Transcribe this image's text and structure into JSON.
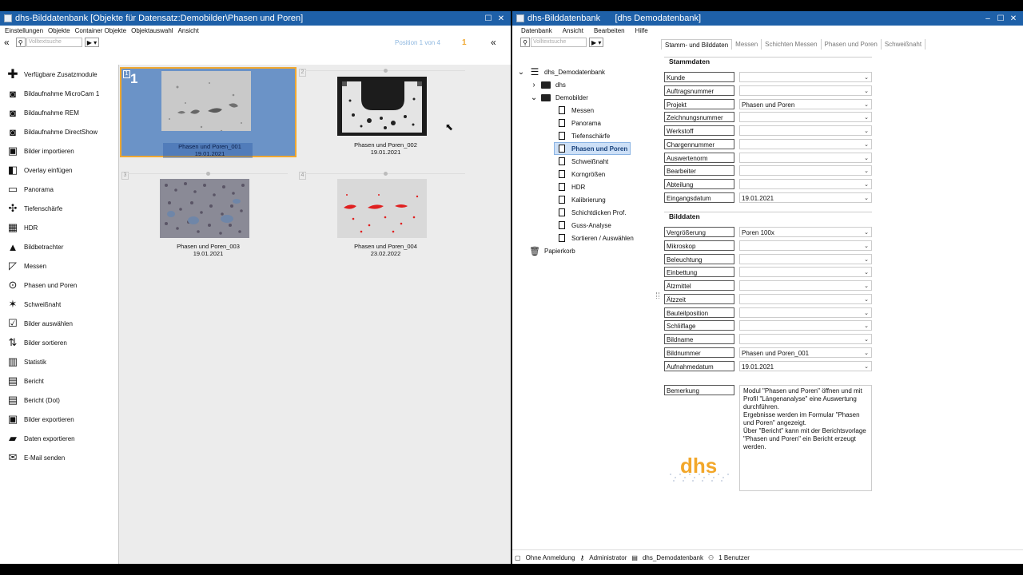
{
  "left_window": {
    "title": "dhs-Bilddatenbank [Objekte für Datensatz:Demobilder\\Phasen und Poren]",
    "menu": [
      "Einstellungen",
      "Objekte",
      "Container Objekte",
      "Objektauswahl",
      "Ansicht"
    ],
    "search_placeholder": "Volltextsuche",
    "position_text": "Position 1 von 4",
    "selected_count": "1",
    "sidebar": [
      {
        "label": "Verfügbare Zusatzmodule",
        "icon": "puzzle-icon",
        "glyph": "✚"
      },
      {
        "label": "Bildaufnahme MicroCam 1",
        "icon": "camera-icon",
        "glyph": "◙"
      },
      {
        "label": "Bildaufnahme REM",
        "icon": "camera-icon",
        "glyph": "◙"
      },
      {
        "label": "Bildaufnahme DirectShow",
        "icon": "camera-icon",
        "glyph": "◙"
      },
      {
        "label": "Bilder importieren",
        "icon": "import-icon",
        "glyph": "▣"
      },
      {
        "label": "Overlay einfügen",
        "icon": "overlay-icon",
        "glyph": "◧"
      },
      {
        "label": "Panorama",
        "icon": "panorama-icon",
        "glyph": "▭"
      },
      {
        "label": "Tiefenschärfe",
        "icon": "focus-icon",
        "glyph": "✣"
      },
      {
        "label": "HDR",
        "icon": "hdr-icon",
        "glyph": "▦"
      },
      {
        "label": "Bildbetrachter",
        "icon": "image-viewer-icon",
        "glyph": "▲"
      },
      {
        "label": "Messen",
        "icon": "measure-icon",
        "glyph": "◸"
      },
      {
        "label": "Phasen und Poren",
        "icon": "phases-icon",
        "glyph": "⊙"
      },
      {
        "label": "Schweißnaht",
        "icon": "weld-icon",
        "glyph": "✶"
      },
      {
        "label": "Bilder auswählen",
        "icon": "checklist-icon",
        "glyph": "☑"
      },
      {
        "label": "Bilder sortieren",
        "icon": "sort-icon",
        "glyph": "⇅"
      },
      {
        "label": "Statistik",
        "icon": "statistics-icon",
        "glyph": "▥"
      },
      {
        "label": "Bericht",
        "icon": "report-icon",
        "glyph": "▤"
      },
      {
        "label": "Bericht (Dot)",
        "icon": "report-dot-icon",
        "glyph": "▤"
      },
      {
        "label": "Bilder exportieren",
        "icon": "export-images-icon",
        "glyph": "▣"
      },
      {
        "label": "Daten exportieren",
        "icon": "export-data-icon",
        "glyph": "▰"
      },
      {
        "label": "E-Mail senden",
        "icon": "mail-icon",
        "glyph": "✉"
      }
    ],
    "thumbnails": [
      {
        "num": "1",
        "name": "Phasen und Poren_001",
        "date": "19.01.2021"
      },
      {
        "num": "2",
        "name": "Phasen und Poren_002",
        "date": "19.01.2021"
      },
      {
        "num": "3",
        "name": "Phasen und Poren_003",
        "date": "19.01.2021"
      },
      {
        "num": "4",
        "name": "Phasen und Poren_004",
        "date": "23.02.2022"
      }
    ]
  },
  "right_window": {
    "title": "dhs-Bilddatenbank      [dhs Demodatenbank]",
    "menu": [
      "Datenbank",
      "Ansicht",
      "Bearbeiten",
      "Hilfe"
    ],
    "search_placeholder": "Volltextsuche",
    "tree": {
      "root": "dhs_Demodatenbank",
      "dhs": "dhs",
      "demobilder": "Demobilder",
      "children": [
        "Messen",
        "Panorama",
        "Tiefenschärfe",
        "Phasen und Poren",
        "Schweißnaht",
        "Korngrößen",
        "HDR",
        "Kalibrierung",
        "Schichtdicken Prof.",
        "Guss-Analyse",
        "Sortieren / Auswählen"
      ],
      "trash": "Papierkorb"
    },
    "tabs": [
      "Stamm- und Bilddaten",
      "Messen",
      "Schichten Messen",
      "Phasen und Poren",
      "Schweißnaht"
    ],
    "stammdaten_title": "Stammdaten",
    "stammdaten": [
      {
        "label": "Kunde",
        "value": ""
      },
      {
        "label": "Auftragsnummer",
        "value": ""
      },
      {
        "label": "Projekt",
        "value": "Phasen und Poren"
      },
      {
        "label": "Zeichnungsnummer",
        "value": ""
      },
      {
        "label": "Werkstoff",
        "value": ""
      },
      {
        "label": "Chargennummer",
        "value": ""
      },
      {
        "label": "Auswertenorm",
        "value": ""
      },
      {
        "label": "Bearbeiter",
        "value": ""
      },
      {
        "label": "Abteilung",
        "value": ""
      },
      {
        "label": "Eingangsdatum",
        "value": "19.01.2021"
      }
    ],
    "bilddaten_title": "Bilddaten",
    "bilddaten": [
      {
        "label": "Vergrößerung",
        "value": "Poren 100x"
      },
      {
        "label": "Mikroskop",
        "value": ""
      },
      {
        "label": "Beleuchtung",
        "value": ""
      },
      {
        "label": "Einbettung",
        "value": ""
      },
      {
        "label": "Ätzmittel",
        "value": ""
      },
      {
        "label": "Ätzzeit",
        "value": ""
      },
      {
        "label": "Bauteilposition",
        "value": ""
      },
      {
        "label": "Schliiflage",
        "value": ""
      },
      {
        "label": "Bildname",
        "value": ""
      },
      {
        "label": "Bildnummer",
        "value": "Phasen und Poren_001"
      },
      {
        "label": "Aufnahmedatum",
        "value": "19.01.2021"
      }
    ],
    "remark_label": "Bemerkung",
    "remark_text": "Modul \"Phasen und Poren\" öffnen und mit Profil \"Längenanalyse\" eine Auswertung durchführen.\nErgebnisse werden im Formular \"Phasen und Poren\" angezeigt.\nÜber \"Bericht\" kann mit der Berichtsvorlage \"Phasen und Poren\" ein Bericht erzeugt werden.",
    "logo_text": "dhs",
    "status": [
      "Ohne Anmeldung",
      "Administrator",
      "dhs_Demodatenbank",
      "1 Benutzer"
    ]
  },
  "colors": {
    "titlebar": "#1e60a8",
    "selection": "#6b93c7",
    "accent": "#f0a830",
    "logo": "#f2a72a"
  }
}
